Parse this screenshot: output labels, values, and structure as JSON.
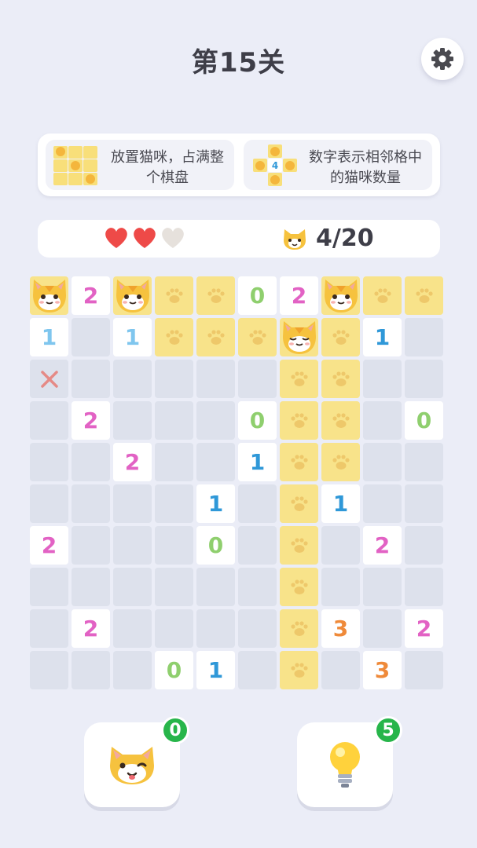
{
  "title": "第15关",
  "rules": [
    {
      "text": "放置猫咪，占满整个棋盘",
      "example_number": ""
    },
    {
      "text": "数字表示相邻格中的猫咪数量",
      "example_number": "4"
    }
  ],
  "lives": {
    "total": 3,
    "remaining": 2
  },
  "cats": {
    "label": "4/20",
    "placed": 4,
    "total": 20
  },
  "colors": {
    "0": "#8fcf6e",
    "1": "#2f98d8",
    "2": "#e262c4",
    "3": "#ef8a3a",
    "1_light": "#7fc6ee"
  },
  "board": [
    [
      "cat",
      "2",
      "cat",
      "paw",
      "paw",
      "0",
      "2",
      "cat",
      "paw",
      "paw"
    ],
    [
      "1L",
      "",
      "1L",
      "paw",
      "paw",
      "paw",
      "catsleep",
      "paw",
      "1",
      ""
    ],
    [
      "x",
      "",
      "",
      "",
      "",
      "",
      "paw",
      "paw",
      "",
      ""
    ],
    [
      "",
      "2",
      "",
      "",
      "",
      "0",
      "paw",
      "paw",
      "",
      "0"
    ],
    [
      "",
      "",
      "2",
      "",
      "",
      "1",
      "paw",
      "paw",
      "",
      ""
    ],
    [
      "",
      "",
      "",
      "",
      "1",
      "",
      "paw",
      "1",
      "",
      ""
    ],
    [
      "2",
      "",
      "",
      "",
      "0",
      "",
      "paw",
      "",
      "2",
      ""
    ],
    [
      "",
      "",
      "",
      "",
      "",
      "",
      "paw",
      "",
      "",
      ""
    ],
    [
      "",
      "2",
      "",
      "",
      "",
      "",
      "paw",
      "3",
      "",
      "2"
    ],
    [
      "",
      "",
      "",
      "0",
      "1",
      "",
      "paw",
      "",
      "3",
      ""
    ]
  ],
  "tools": [
    {
      "name": "cat-hint",
      "icon": "winking-cat-icon",
      "count": "0"
    },
    {
      "name": "lightbulb-hint",
      "icon": "lightbulb-icon",
      "count": "5"
    }
  ]
}
